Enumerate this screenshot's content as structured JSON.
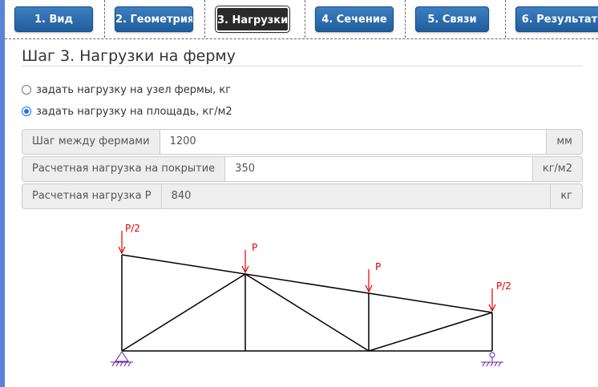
{
  "nav": {
    "tabs": [
      {
        "label": "1. Вид",
        "active": false
      },
      {
        "label": "2. Геометрия",
        "active": false
      },
      {
        "label": "3. Нагрузки",
        "active": true
      },
      {
        "label": "4. Сечение",
        "active": false
      },
      {
        "label": "5. Связи",
        "active": false
      },
      {
        "label": "6. Результат",
        "active": false
      }
    ]
  },
  "page": {
    "title": "Шаг 3. Нагрузки на ферму"
  },
  "options": {
    "node_load": {
      "label": "задать нагрузку на узел фермы, кг",
      "checked": false
    },
    "area_load": {
      "label": "задать нагрузку на площадь, кг/м2",
      "checked": true
    }
  },
  "fields": [
    {
      "label": "Шаг между фермами",
      "value": "1200",
      "unit": "мм",
      "readonly": false
    },
    {
      "label": "Расчетная нагрузка на покрытие",
      "value": "350",
      "unit": "кг/м2",
      "readonly": false
    },
    {
      "label": "Расчетная нагрузка P",
      "value": "840",
      "unit": "кг",
      "readonly": true
    }
  ],
  "diagram": {
    "load_labels": [
      "P/2",
      "P",
      "P",
      "P/2"
    ],
    "load_color": "#e00000",
    "support_color": "#6a1fa8"
  }
}
